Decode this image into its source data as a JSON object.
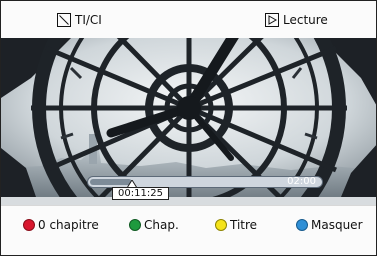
{
  "top": {
    "left_label": "TI/CI",
    "right_label": "Lecture",
    "left_icon": "skip-icon",
    "right_icon": "play-icon"
  },
  "progress": {
    "total_time": "02:00",
    "current_time": "00:11:25",
    "fraction": 0.18
  },
  "buttons": [
    {
      "label": "0 chapitre",
      "color": "#d8172e",
      "border": "#8a0d1a"
    },
    {
      "label": "Chap.",
      "color": "#1e9a3e",
      "border": "#0f5a22"
    },
    {
      "label": "Titre",
      "color": "#f5e31a",
      "border": "#8e8400"
    },
    {
      "label": "Masquer",
      "color": "#2f8fd6",
      "border": "#175b8e"
    }
  ]
}
